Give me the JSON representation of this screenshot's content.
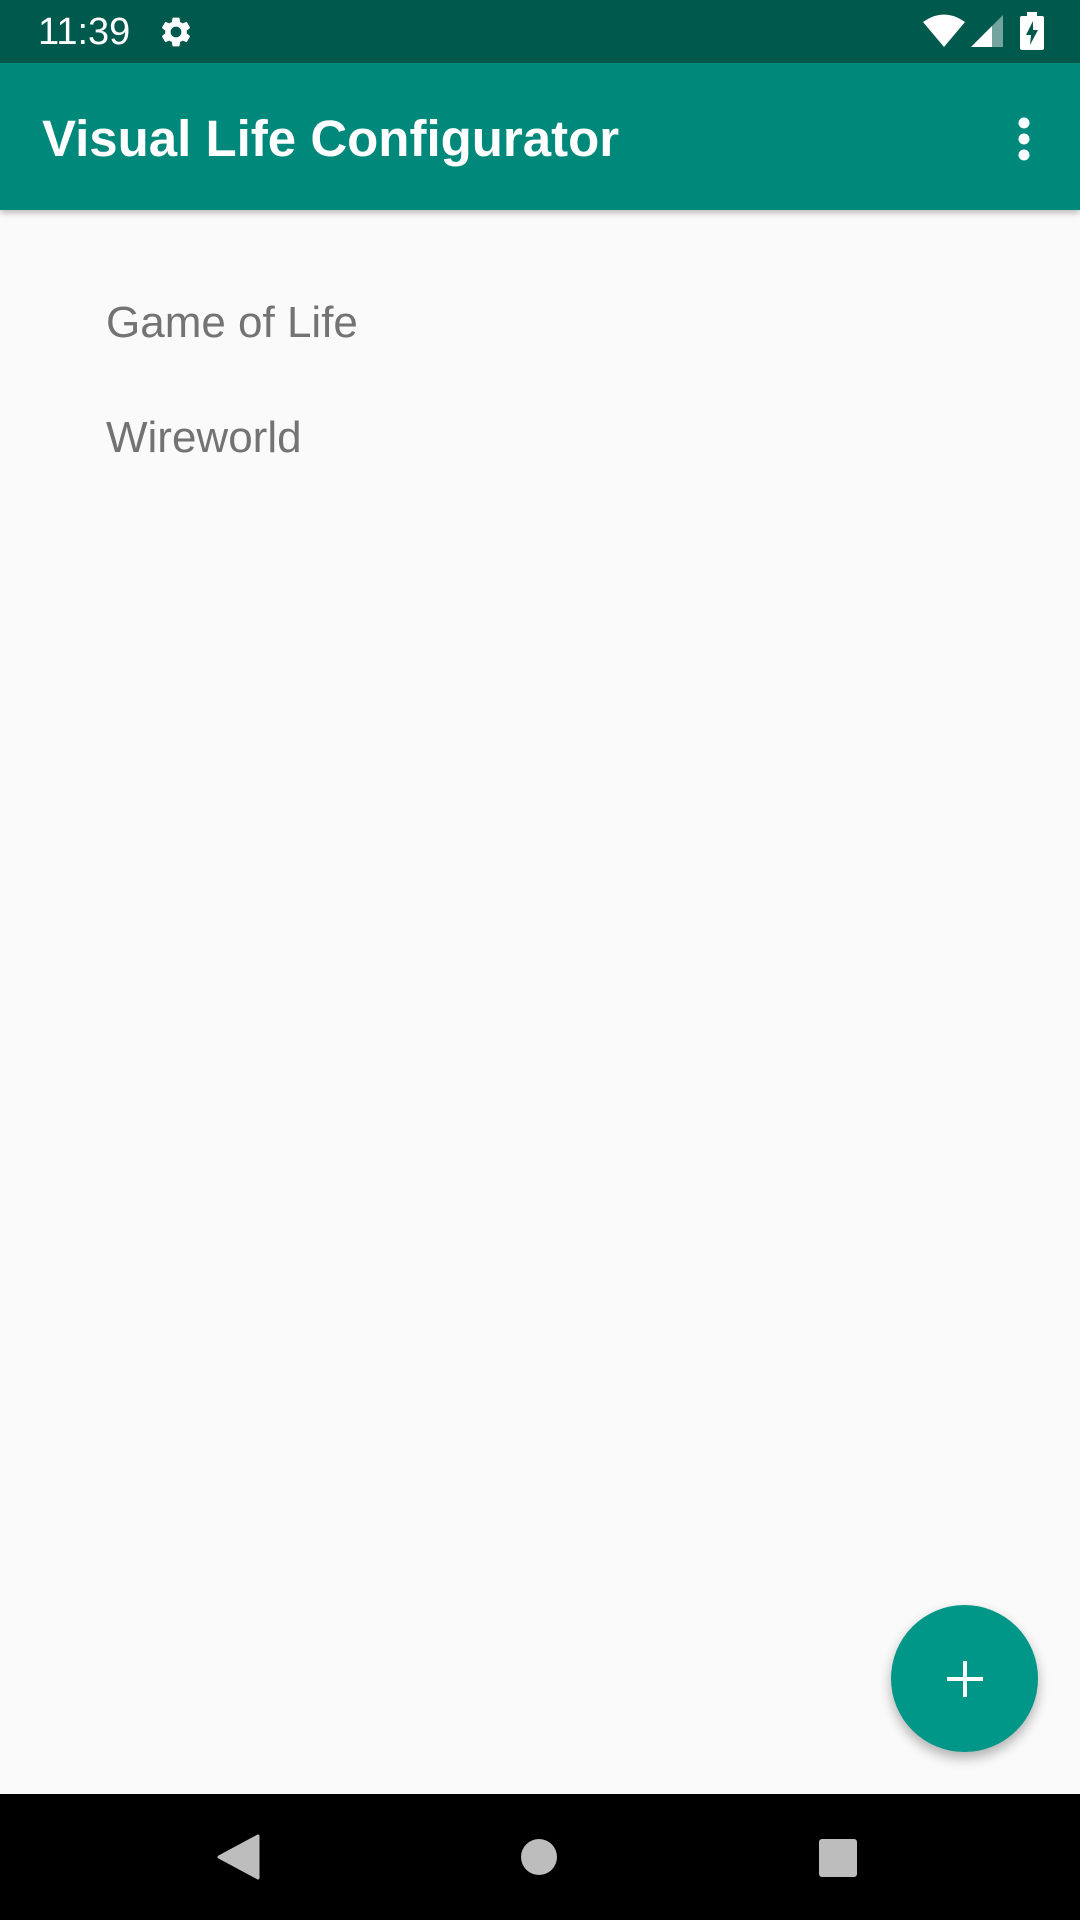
{
  "status_bar": {
    "time": "11:39",
    "icons": [
      "gear-icon",
      "wifi-icon",
      "cell-signal-icon",
      "battery-charging-icon"
    ]
  },
  "app_bar": {
    "title": "Visual Life Configurator",
    "overflow_icon": "more-vert-icon"
  },
  "list": {
    "items": [
      {
        "label": "Game of Life"
      },
      {
        "label": "Wireworld"
      }
    ]
  },
  "fab": {
    "icon": "add-icon",
    "color": "#009688"
  },
  "nav_bar": {
    "icons": [
      "back-icon",
      "home-icon",
      "recents-icon"
    ]
  },
  "colors": {
    "status_bar": "#00594d",
    "app_bar": "#00897b",
    "background": "#fafafa",
    "list_text": "#737373"
  }
}
